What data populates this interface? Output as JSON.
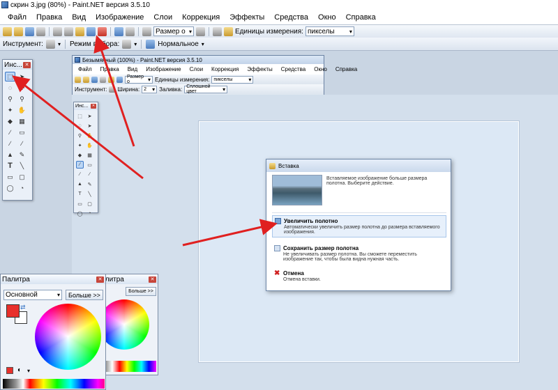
{
  "window": {
    "title": "скрин 3.jpg (80%) - Paint.NET версия 3.5.10"
  },
  "menu": [
    "Файл",
    "Правка",
    "Вид",
    "Изображение",
    "Слои",
    "Коррекция",
    "Эффекты",
    "Средства",
    "Окно",
    "Справка"
  ],
  "toolbar": {
    "zoom_value": "Размер о",
    "units_label": "Единицы измерения:",
    "units_value": "пикселы"
  },
  "toolbar2": {
    "tool_label": "Инструмент:",
    "mode_label": "Режим выбора:",
    "mode_value": "Нормальное"
  },
  "tools_panel": {
    "title": "Инс..."
  },
  "inner": {
    "title": "Безымянный (100%) - Paint.NET версия 3.5.10",
    "menu": [
      "Файл",
      "Правка",
      "Вид",
      "Изображение",
      "Слои",
      "Коррекция",
      "Эффекты",
      "Средства",
      "Окно",
      "Справка"
    ],
    "units_label": "Единицы измерения:",
    "units_value": "пикселы",
    "zoom_value": "Размер о",
    "tool_label": "Инструмент:",
    "width_label": "Ширина:",
    "width_value": "2",
    "fill_label": "Заливка:",
    "fill_value": "Сплошной цвет",
    "tools_title": "Инс..."
  },
  "dialog": {
    "title": "Вставка",
    "message": "Вставляемое изображение больше размера полотна. Выберите действие.",
    "options": [
      {
        "title": "Увеличить полотно",
        "desc": "Автоматически увеличить размер полотна до размера вставляемого изображения."
      },
      {
        "title": "Сохранить размер полотна",
        "desc": "Не увеличивать размер полотна. Вы сможете переместить изображение так, чтобы была видна нужная часть."
      },
      {
        "title": "Отмена",
        "desc": "Отмена вставки."
      }
    ]
  },
  "palette": {
    "title": "Палитра",
    "mode": "Основной",
    "more": "Больше >>"
  },
  "palette_inner": {
    "title": "Палитра",
    "more": "Больше >>"
  },
  "colors": {
    "primary": "#e8302b",
    "arrow": "#e02020",
    "accent": "#3b78c6"
  }
}
